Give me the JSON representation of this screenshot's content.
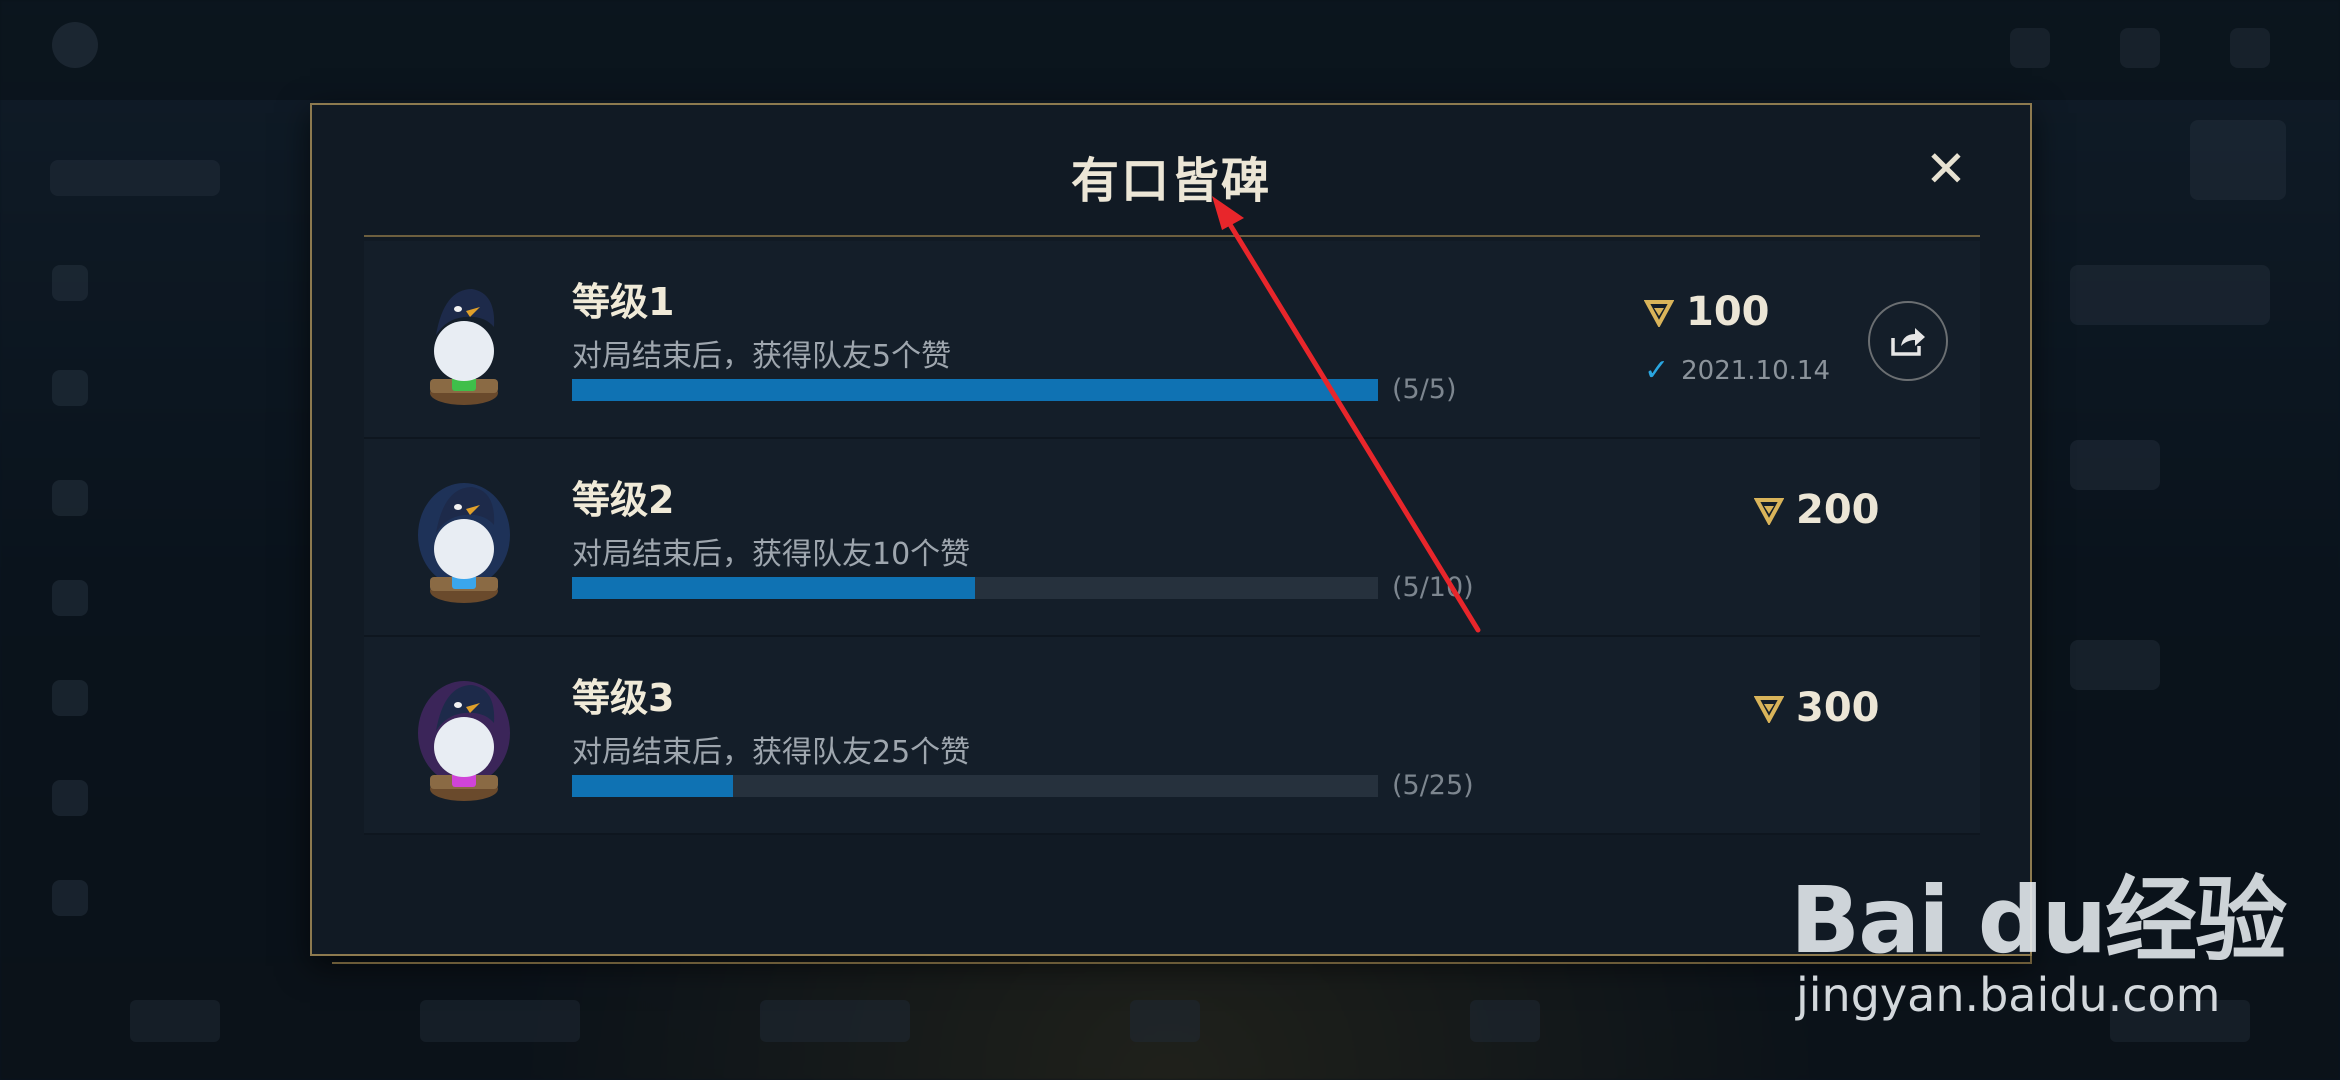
{
  "dialog": {
    "title": "有口皆碑",
    "close_label": "✕"
  },
  "tiers": [
    {
      "name": "等级1",
      "description": "对局结束后，获得队友5个赞",
      "progress_text": "(5/5)",
      "progress": 1.0,
      "reward": "100",
      "claimed_date": "2021.10.14",
      "gem_color": "#3fbf4a",
      "aura_color": ""
    },
    {
      "name": "等级2",
      "description": "对局结束后，获得队友10个赞",
      "progress_text": "(5/10)",
      "progress": 0.5,
      "reward": "200",
      "gem_color": "#3aa6ec",
      "aura_color": "#3b6fe8"
    },
    {
      "name": "等级3",
      "description": "对局结束后，获得队友25个赞",
      "progress_text": "(5/25)",
      "progress": 0.2,
      "reward": "300",
      "gem_color": "#d044d8",
      "aura_color": "#a03ad8"
    }
  ],
  "icons": {
    "reward": "gold-token-icon",
    "check": "check-icon",
    "share": "share-icon",
    "close": "close-icon"
  },
  "colors": {
    "accent_gold": "#8d7a4f",
    "progress_fill": "#0f72b3",
    "check": "#2aa6e0",
    "annotation_arrow": "#e8262b"
  },
  "watermark": {
    "brand": "Bai du经验",
    "site": "jingyan.baidu.com"
  }
}
